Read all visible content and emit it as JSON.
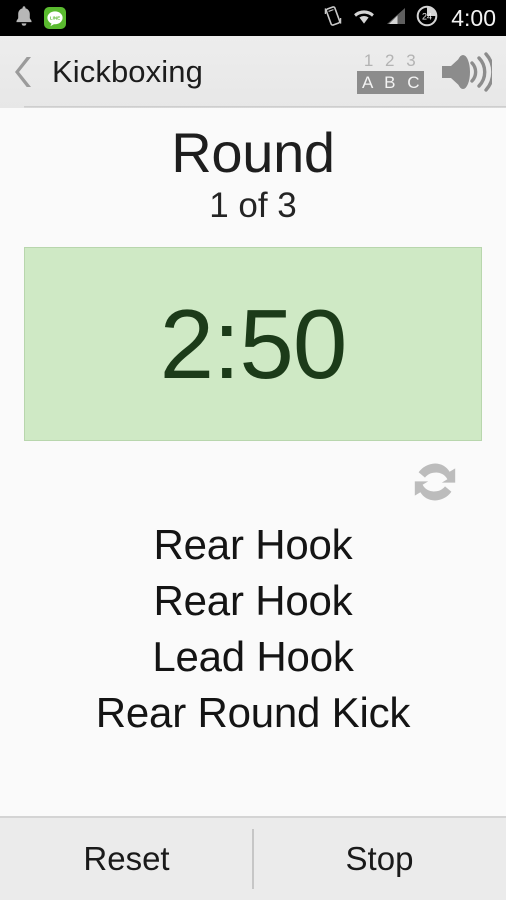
{
  "status_bar": {
    "background": "#000000",
    "time": "4:00",
    "left_icons": [
      {
        "name": "notification-bell-icon",
        "label": "bell"
      },
      {
        "name": "line-app-icon",
        "label": "LINE",
        "color": "#5aba2f"
      }
    ],
    "right_icons": [
      {
        "name": "vibrate-icon",
        "label": "vibrate"
      },
      {
        "name": "wifi-icon",
        "label": "wifi"
      },
      {
        "name": "cellular-signal-icon",
        "label": "signal"
      },
      {
        "name": "battery-24-icon",
        "label": "24"
      }
    ]
  },
  "header": {
    "back_icon": "back-chevron-icon",
    "title": "Kickboxing",
    "numeric_row": "1 2 3",
    "alpha_row": "A B C",
    "mode_toggle_name": "123-abc-toggle-icon",
    "volume_icon": "speaker-volume-icon"
  },
  "main": {
    "round_label": "Round",
    "round_progress": "1 of 3",
    "timer": {
      "value": "2:50",
      "panel_bg": "#cfe9c5",
      "panel_border": "#b8d6ad",
      "text_color": "#1c3b19"
    },
    "refresh_icon": "refresh-sync-icon",
    "combo": [
      "Rear Hook",
      "Rear Hook",
      "Lead Hook",
      "Rear Round Kick"
    ]
  },
  "bottom_bar": {
    "reset_label": "Reset",
    "stop_label": "Stop"
  }
}
